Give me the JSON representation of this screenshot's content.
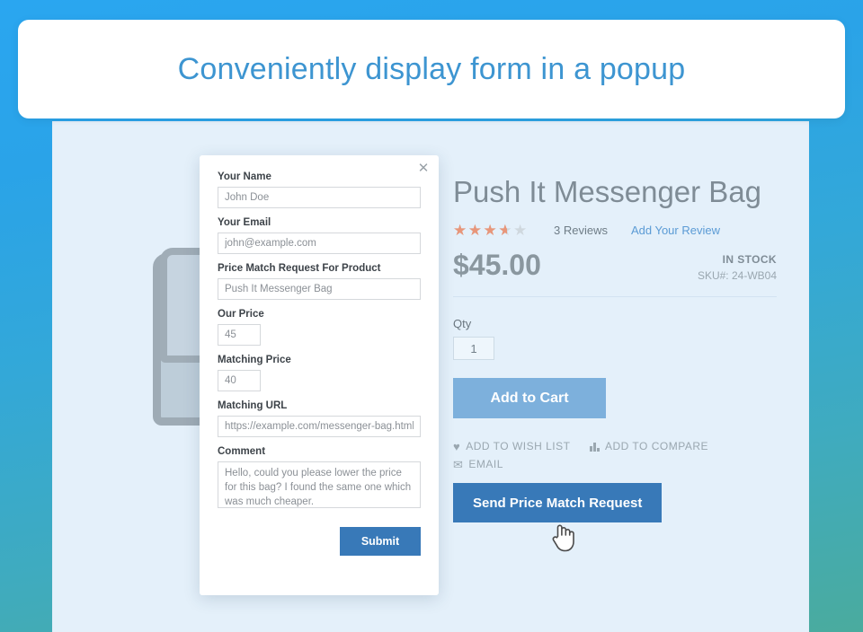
{
  "banner": {
    "title": "Conveniently display form in a popup",
    "accent_color": "#3d95d1"
  },
  "modal": {
    "close_icon": "close-icon",
    "close_glyph": "✕",
    "fields": [
      {
        "label": "Your Name",
        "value": "John Doe",
        "type": "text",
        "size": "full"
      },
      {
        "label": "Your Email",
        "value": "john@example.com",
        "type": "email",
        "size": "full"
      },
      {
        "label": "Price Match Request For Product",
        "value": "Push It Messenger Bag",
        "type": "text",
        "size": "full"
      },
      {
        "label": "Our Price",
        "value": "45",
        "type": "text",
        "size": "small"
      },
      {
        "label": "Matching Price",
        "value": "40",
        "type": "text",
        "size": "small"
      },
      {
        "label": "Matching URL",
        "value": "https://example.com/messenger-bag.html",
        "type": "url",
        "size": "full"
      }
    ],
    "comment": {
      "label": "Comment",
      "value": "Hello, could you please lower the price for this bag? I found the same one which was much cheaper."
    },
    "submit_label": "Submit",
    "submit_color": "#3879b8"
  },
  "product": {
    "title": "Push It Messenger Bag",
    "rating_stars": 3.5,
    "rating_percent": "70%",
    "stars_glyphs": "★★★★★",
    "star_color": "#e8967a",
    "reviews_label": "3  Reviews",
    "add_review_label": "Add Your Review",
    "price": "$45.00",
    "stock_status": "IN STOCK",
    "sku_line": "SKU#:  24-WB04",
    "qty_label": "Qty",
    "qty_value": "1",
    "add_to_cart_label": "Add to Cart",
    "add_to_cart_color": "#7db0dc",
    "links": [
      {
        "icon": "heart-icon",
        "glyph": "♥",
        "label": "ADD TO WISH LIST"
      },
      {
        "icon": "compare-bars-icon",
        "glyph": "",
        "label": "ADD TO COMPARE"
      },
      {
        "icon": "envelope-icon",
        "glyph": "✉",
        "label": "EMAIL"
      }
    ],
    "send_request_label": "Send Price Match Request",
    "send_request_color": "#3879b8"
  },
  "cursor": {
    "icon": "hand-pointer-cursor"
  }
}
